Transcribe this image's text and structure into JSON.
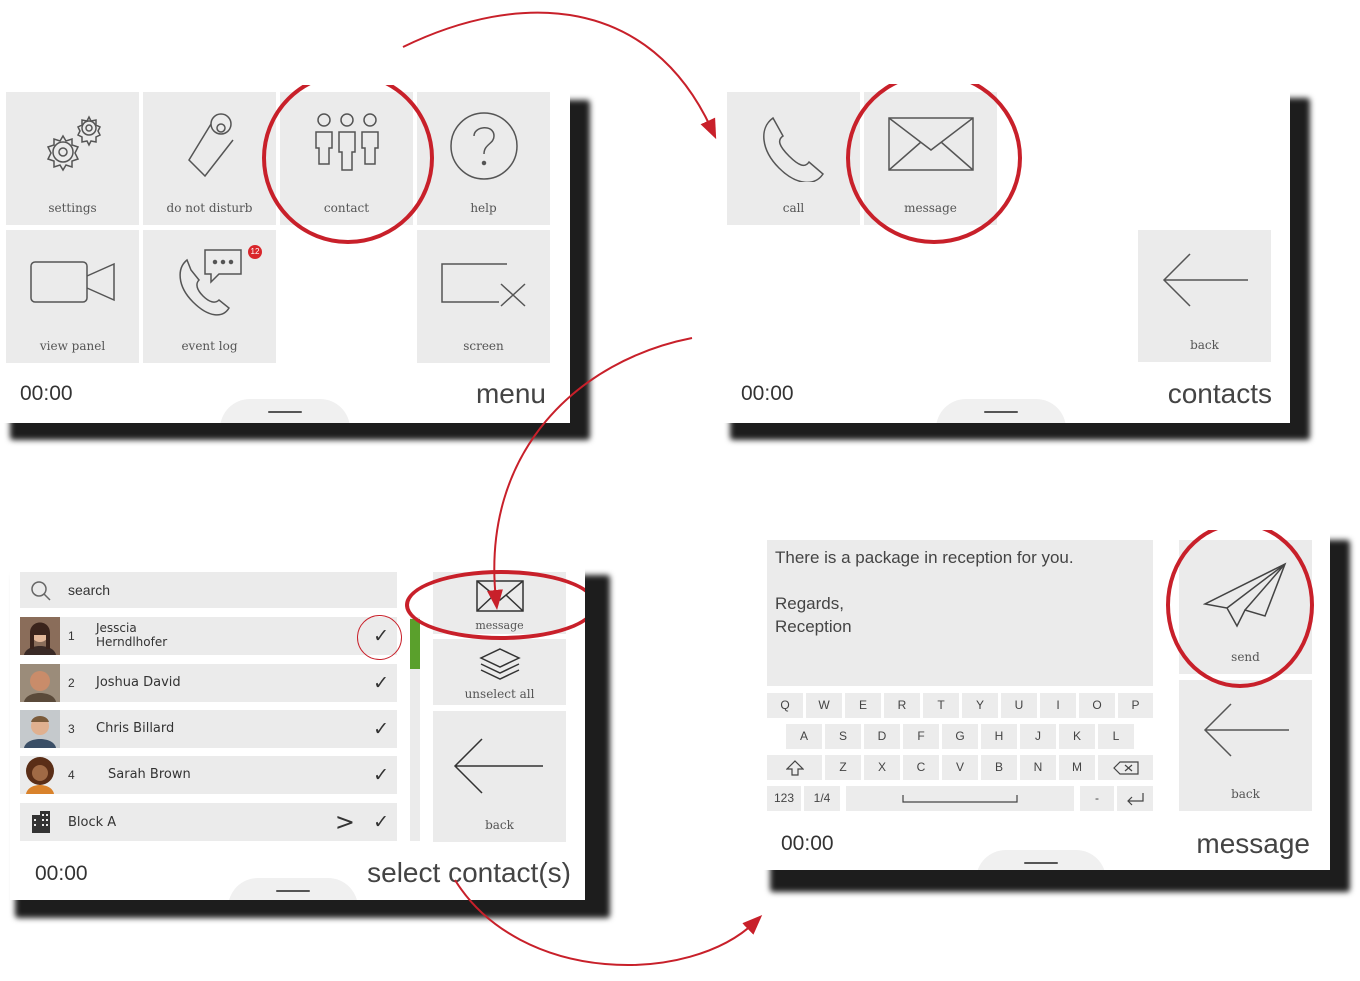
{
  "accent_color": "#c8202a",
  "menu_screen": {
    "tiles": [
      {
        "label": "settings",
        "icon": "gears-icon"
      },
      {
        "label": "do not disturb",
        "icon": "door-hanger-icon"
      },
      {
        "label": "contact",
        "icon": "people-icon"
      },
      {
        "label": "help",
        "icon": "question-icon"
      },
      {
        "label": "view panel",
        "icon": "video-camera-icon"
      },
      {
        "label": "event log",
        "icon": "phone-message-icon",
        "badge": "12"
      },
      {
        "label": "screen",
        "icon": "screen-off-icon"
      }
    ],
    "time": "00:00",
    "title": "menu"
  },
  "contacts_screen": {
    "tiles": [
      {
        "label": "call",
        "icon": "phone-icon"
      },
      {
        "label": "message",
        "icon": "envelope-icon"
      },
      {
        "label": "back",
        "icon": "arrow-left-icon"
      }
    ],
    "time": "00:00",
    "title": "contacts"
  },
  "select_screen": {
    "search_placeholder": "search",
    "contacts": [
      {
        "num": "1",
        "name_line1": "Jesscia",
        "name_line2": "Herndlhofer",
        "checked": true
      },
      {
        "num": "2",
        "name": "Joshua David",
        "checked": true
      },
      {
        "num": "3",
        "name": "Chris Billard",
        "checked": true
      },
      {
        "num": "4",
        "name": "Sarah Brown",
        "checked": true
      }
    ],
    "group": {
      "name": "Block A",
      "chevron": ">",
      "checked": true
    },
    "check_mark": "✓",
    "buttons": [
      {
        "label": "message",
        "icon": "envelope-icon"
      },
      {
        "label": "unselect all",
        "icon": "layers-icon"
      },
      {
        "label": "back",
        "icon": "arrow-left-icon"
      }
    ],
    "time": "00:00",
    "title": "select contact(s)"
  },
  "message_screen": {
    "message_line1": "There is a package in reception for you.",
    "message_line2": "Regards,",
    "message_line3": "Reception",
    "keyboard": {
      "row1": [
        "Q",
        "W",
        "E",
        "R",
        "T",
        "Y",
        "U",
        "I",
        "O",
        "P"
      ],
      "row2": [
        "A",
        "S",
        "D",
        "F",
        "G",
        "H",
        "J",
        "K",
        "L"
      ],
      "row3": [
        "Z",
        "X",
        "C",
        "V",
        "B",
        "N",
        "M"
      ],
      "mode_key": "123",
      "page_key": "1/4",
      "dash_key": "-"
    },
    "buttons": [
      {
        "label": "send",
        "icon": "paper-plane-icon"
      },
      {
        "label": "back",
        "icon": "arrow-left-icon"
      }
    ],
    "time": "00:00",
    "title": "message"
  }
}
